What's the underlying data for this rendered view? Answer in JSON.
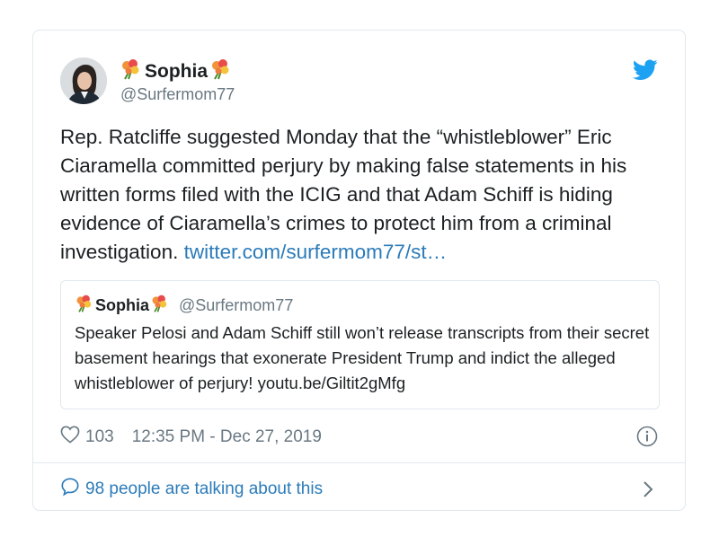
{
  "tweet": {
    "author_name": "Sophia",
    "author_handle": "@Surfermom77",
    "text": "Rep. Ratcliffe suggested Monday that the “whistleblower” Eric Ciaramella committed perjury by making false statements in his written forms filed with the ICIG and that Adam Schiff is hiding evidence of Ciaramella’s crimes to protect him from a criminal investigation. ",
    "link": "twitter.com/surfermom77/st…",
    "likes": "103",
    "timestamp": "12:35 PM - Dec 27, 2019"
  },
  "quoted": {
    "author_name": "Sophia",
    "author_handle": "@Surfermom77",
    "text": "Speaker Pelosi and Adam Schiff still won’t release transcripts from their secret basement hearings that exonerate President Trump and indict the alleged whistleblower of perjury! youtu.be/Giltit2gMfg"
  },
  "footer": {
    "talking": "98 people are talking about this"
  },
  "colors": {
    "twitter_blue": "#1da1f2",
    "link": "#2b7bb9",
    "muted": "#697882",
    "border": "#e1e8ed"
  }
}
